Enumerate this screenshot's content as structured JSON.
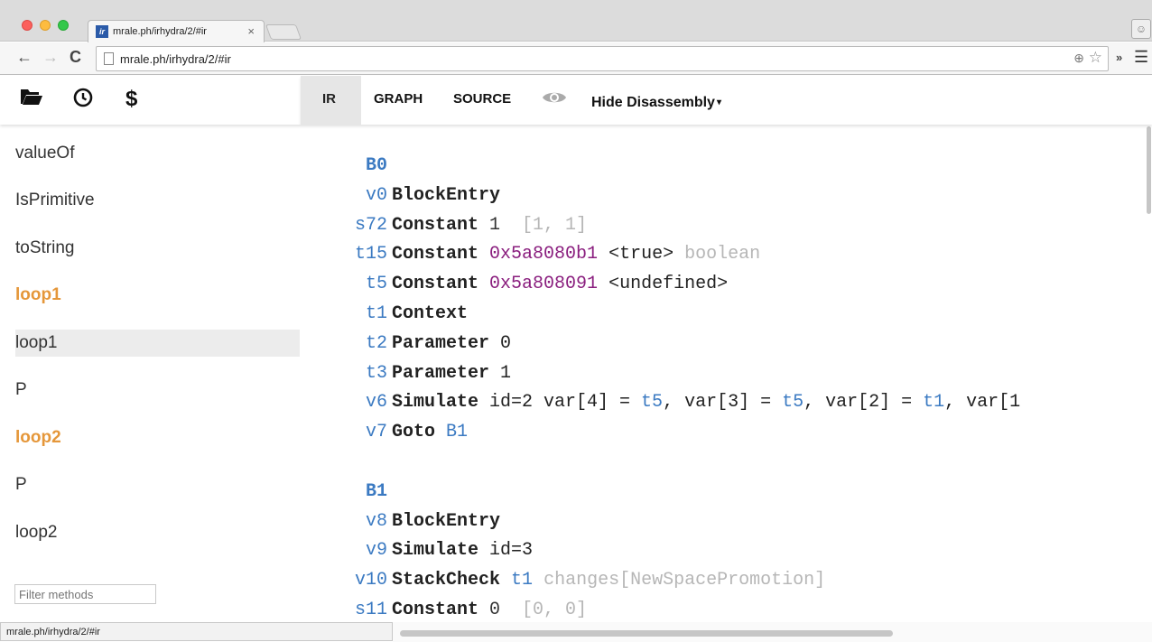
{
  "browser": {
    "tab_favicon": "ir",
    "tab_title": "mrale.ph/irhydra/2/#ir",
    "tab_close": "×",
    "url": "mrale.ph/irhydra/2/#ir",
    "status_url": "mrale.ph/irhydra/2/#ir"
  },
  "header": {
    "tabs": [
      "IR",
      "GRAPH",
      "SOURCE"
    ],
    "disassembly_label": "Hide Disassembly",
    "caret": "▾"
  },
  "sidebar": {
    "methods": [
      {
        "label": "valueOf",
        "style": "normal"
      },
      {
        "label": "IsPrimitive",
        "style": "normal"
      },
      {
        "label": "toString",
        "style": "normal"
      },
      {
        "label": "loop1",
        "style": "hot"
      },
      {
        "label": "loop1",
        "style": "selected"
      },
      {
        "label": "P",
        "style": "normal"
      },
      {
        "label": "loop2",
        "style": "hot"
      },
      {
        "label": "P",
        "style": "normal"
      },
      {
        "label": "loop2",
        "style": "normal"
      }
    ],
    "filter_placeholder": "Filter methods"
  },
  "ir": {
    "lines": [
      {
        "id": "B0",
        "kind": "block",
        "parts": []
      },
      {
        "id": "v0",
        "kind": "instr",
        "parts": [
          {
            "t": "BlockEntry",
            "c": "op"
          }
        ]
      },
      {
        "id": "s72",
        "kind": "instr",
        "parts": [
          {
            "t": "Constant",
            "c": "op"
          },
          {
            "t": " 1  ",
            "c": "num"
          },
          {
            "t": "[1, 1]",
            "c": "dim"
          }
        ]
      },
      {
        "id": "t15",
        "kind": "instr",
        "parts": [
          {
            "t": "Constant",
            "c": "op"
          },
          {
            "t": " ",
            "c": "plain"
          },
          {
            "t": "0x5a8080b1",
            "c": "hex"
          },
          {
            "t": " <true> ",
            "c": "plain"
          },
          {
            "t": "boolean",
            "c": "dim"
          }
        ]
      },
      {
        "id": "t5",
        "kind": "instr",
        "parts": [
          {
            "t": "Constant",
            "c": "op"
          },
          {
            "t": " ",
            "c": "plain"
          },
          {
            "t": "0x5a808091",
            "c": "hex"
          },
          {
            "t": " <undefined>",
            "c": "plain"
          }
        ]
      },
      {
        "id": "t1",
        "kind": "instr",
        "parts": [
          {
            "t": "Context",
            "c": "op"
          }
        ]
      },
      {
        "id": "t2",
        "kind": "instr",
        "parts": [
          {
            "t": "Parameter",
            "c": "op"
          },
          {
            "t": " 0",
            "c": "plain"
          }
        ]
      },
      {
        "id": "t3",
        "kind": "instr",
        "parts": [
          {
            "t": "Parameter",
            "c": "op"
          },
          {
            "t": " 1",
            "c": "plain"
          }
        ]
      },
      {
        "id": "v6",
        "kind": "instr",
        "parts": [
          {
            "t": "Simulate",
            "c": "op"
          },
          {
            "t": " id=2 var[4] = ",
            "c": "plain"
          },
          {
            "t": "t5",
            "c": "id"
          },
          {
            "t": ", var[3] = ",
            "c": "plain"
          },
          {
            "t": "t5",
            "c": "id"
          },
          {
            "t": ", var[2] = ",
            "c": "plain"
          },
          {
            "t": "t1",
            "c": "id"
          },
          {
            "t": ", var[1",
            "c": "plain"
          }
        ]
      },
      {
        "id": "v7",
        "kind": "instr",
        "parts": [
          {
            "t": "Goto",
            "c": "op"
          },
          {
            "t": " ",
            "c": "plain"
          },
          {
            "t": "B1",
            "c": "id"
          }
        ]
      },
      {
        "id": "",
        "kind": "blank",
        "parts": []
      },
      {
        "id": "B1",
        "kind": "block",
        "parts": []
      },
      {
        "id": "v8",
        "kind": "instr",
        "parts": [
          {
            "t": "BlockEntry",
            "c": "op"
          }
        ]
      },
      {
        "id": "v9",
        "kind": "instr",
        "parts": [
          {
            "t": "Simulate",
            "c": "op"
          },
          {
            "t": " id=3",
            "c": "plain"
          }
        ]
      },
      {
        "id": "v10",
        "kind": "instr",
        "parts": [
          {
            "t": "StackCheck",
            "c": "op"
          },
          {
            "t": " ",
            "c": "plain"
          },
          {
            "t": "t1",
            "c": "id"
          },
          {
            "t": " ",
            "c": "plain"
          },
          {
            "t": "changes[NewSpacePromotion]",
            "c": "dim"
          }
        ]
      },
      {
        "id": "s11",
        "kind": "instr",
        "parts": [
          {
            "t": "Constant",
            "c": "op"
          },
          {
            "t": " 0  ",
            "c": "num"
          },
          {
            "t": "[0, 0]",
            "c": "dim"
          }
        ]
      }
    ]
  }
}
